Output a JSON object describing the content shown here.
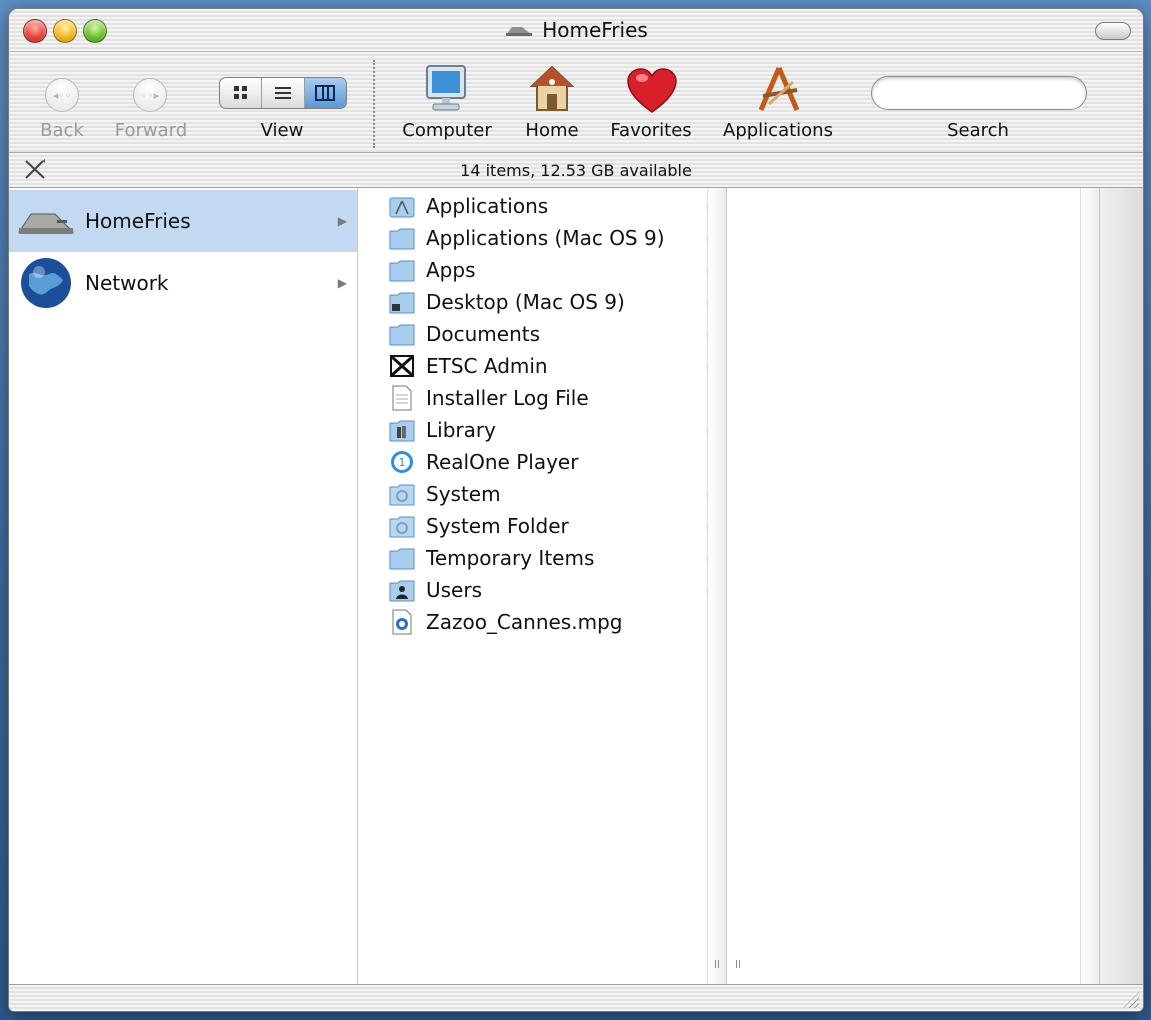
{
  "window": {
    "title": "HomeFries"
  },
  "toolbar": {
    "back_label": "Back",
    "forward_label": "Forward",
    "view_label": "View",
    "computer_label": "Computer",
    "home_label": "Home",
    "favorites_label": "Favorites",
    "applications_label": "Applications",
    "search_label": "Search",
    "search_value": "",
    "view_modes": [
      "icon-view-icon",
      "list-view-icon",
      "column-view-icon"
    ],
    "active_view": "column"
  },
  "status": {
    "text": "14 items, 12.53 GB available"
  },
  "sidebar": {
    "items": [
      {
        "label": "HomeFries",
        "icon": "hard-disk-icon",
        "selected": true
      },
      {
        "label": "Network",
        "icon": "globe-icon",
        "selected": false
      }
    ]
  },
  "files": {
    "items": [
      {
        "label": "Applications",
        "icon": "applications-folder-icon",
        "has_children": true
      },
      {
        "label": "Applications (Mac OS 9)",
        "icon": "folder-icon",
        "has_children": true
      },
      {
        "label": "Apps",
        "icon": "folder-icon",
        "has_children": true
      },
      {
        "label": "Desktop (Mac OS 9)",
        "icon": "desktop-folder-icon",
        "has_children": true
      },
      {
        "label": "Documents",
        "icon": "folder-icon",
        "has_children": true
      },
      {
        "label": "ETSC Admin",
        "icon": "restricted-folder-icon",
        "has_children": true
      },
      {
        "label": "Installer Log File",
        "icon": "document-icon",
        "has_children": false
      },
      {
        "label": "Library",
        "icon": "library-folder-icon",
        "has_children": true
      },
      {
        "label": "RealOne Player",
        "icon": "realone-icon",
        "has_children": false
      },
      {
        "label": "System",
        "icon": "system-folder-icon",
        "has_children": true
      },
      {
        "label": "System Folder",
        "icon": "system-folder-icon",
        "has_children": true
      },
      {
        "label": "Temporary Items",
        "icon": "folder-icon",
        "has_children": true
      },
      {
        "label": "Users",
        "icon": "users-folder-icon",
        "has_children": true
      },
      {
        "label": "Zazoo_Cannes.mpg",
        "icon": "movie-file-icon",
        "has_children": false
      }
    ]
  },
  "colors": {
    "selection": "#c3d9f1",
    "active_segment": "#5c97d6",
    "desktop": "#3f6fa6"
  }
}
